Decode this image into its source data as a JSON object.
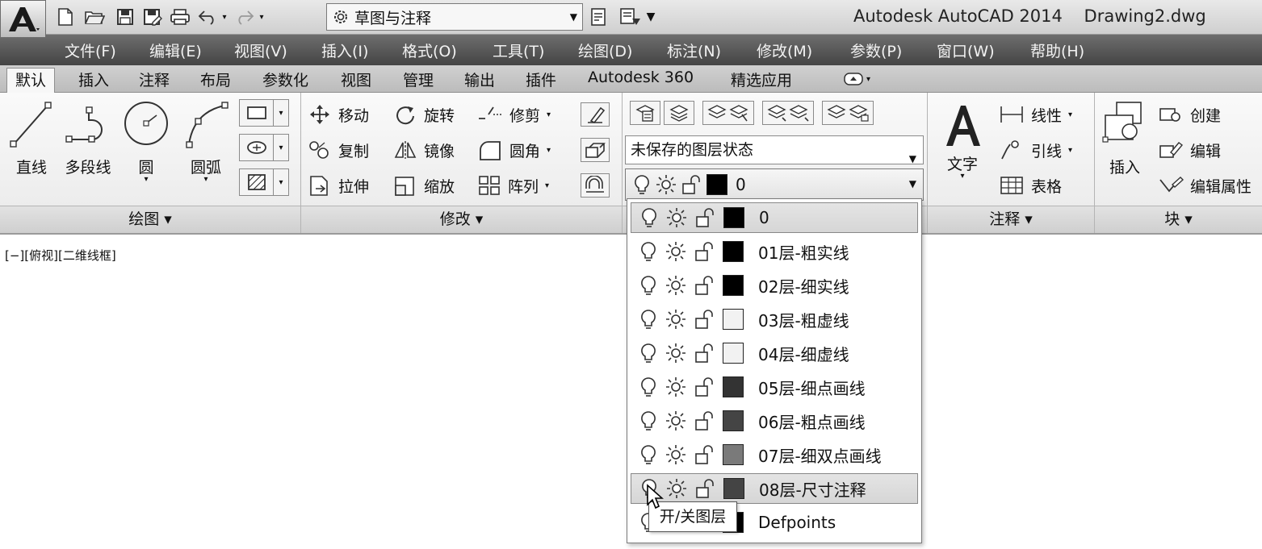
{
  "app_title": "Autodesk AutoCAD 2014    Drawing2.dwg",
  "quick_access": {
    "icons": [
      "new-icon",
      "open-icon",
      "save-icon",
      "save-as-icon",
      "plot-icon",
      "undo-icon",
      "redo-icon"
    ],
    "workspace": "草图与注释"
  },
  "menu": [
    "文件(F)",
    "编辑(E)",
    "视图(V)",
    "插入(I)",
    "格式(O)",
    "工具(T)",
    "绘图(D)",
    "标注(N)",
    "修改(M)",
    "参数(P)",
    "窗口(W)",
    "帮助(H)"
  ],
  "tabs": [
    "默认",
    "插入",
    "注释",
    "布局",
    "参数化",
    "视图",
    "管理",
    "输出",
    "插件",
    "Autodesk 360",
    "精选应用"
  ],
  "active_tab": "默认",
  "panels": {
    "draw": {
      "title": "绘图 ▾",
      "tools": [
        "直线",
        "多段线",
        "圆",
        "圆弧"
      ]
    },
    "modify": {
      "title": "修改 ▾",
      "tools": [
        "移动",
        "旋转",
        "修剪",
        "复制",
        "镜像",
        "圆角",
        "拉伸",
        "缩放",
        "阵列"
      ]
    },
    "layers": {
      "state": "未保存的图层状态",
      "current_layer": "0"
    },
    "annotation": {
      "title": "注释 ▾",
      "text_tool": "文字",
      "tools": [
        "线性",
        "引线",
        "表格"
      ]
    },
    "block": {
      "title": "块 ▾",
      "insert": "插入",
      "tools": [
        "创建",
        "编辑",
        "编辑属性"
      ]
    }
  },
  "viewport_label": "[−][俯视][二维线框]",
  "layer_list": [
    {
      "name": "0",
      "color": "#000000"
    },
    {
      "name": "01层-粗实线",
      "color": "#000000"
    },
    {
      "name": "02层-细实线",
      "color": "#000000"
    },
    {
      "name": "03层-粗虚线",
      "color": "#f2f2f2"
    },
    {
      "name": "04层-细虚线",
      "color": "#f2f2f2"
    },
    {
      "name": "05层-细点画线",
      "color": "#333333"
    },
    {
      "name": "06层-粗点画线",
      "color": "#444444"
    },
    {
      "name": "07层-细双点画线",
      "color": "#7a7a7a"
    },
    {
      "name": "08层-尺寸注释",
      "color": "#444444"
    },
    {
      "name": "Defpoints",
      "color": "#000000"
    }
  ],
  "highlighted_layers": [
    "0",
    "08层-尺寸注释"
  ],
  "tooltip": "开/关图层"
}
